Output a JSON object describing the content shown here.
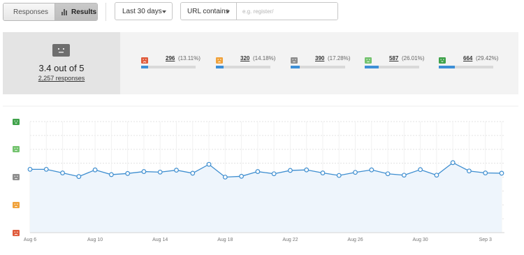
{
  "toolbar": {
    "tabs": [
      {
        "label": "Responses",
        "icon": "list-icon",
        "active": false
      },
      {
        "label": "Results",
        "icon": "bar-chart-icon",
        "active": true
      }
    ],
    "date_range": "Last 30 days",
    "url_filter": {
      "mode": "URL contains",
      "placeholder": "e.g. register/",
      "value": ""
    }
  },
  "summary": {
    "face_icon": "neutral-face-icon",
    "score": "3.4 out of 5",
    "responses": "2,257 responses",
    "ratings": [
      {
        "face": "very-unhappy-face-icon",
        "color": "#e05b3c",
        "count": "296",
        "percent": "(13.11%)",
        "fraction": 0.1311
      },
      {
        "face": "unhappy-face-icon",
        "color": "#f0a23b",
        "count": "320",
        "percent": "(14.18%)",
        "fraction": 0.1418
      },
      {
        "face": "neutral-face-icon",
        "color": "#8e8e8e",
        "count": "390",
        "percent": "(17.28%)",
        "fraction": 0.1728
      },
      {
        "face": "happy-face-icon",
        "color": "#74c36f",
        "count": "587",
        "percent": "(26.01%)",
        "fraction": 0.2601
      },
      {
        "face": "very-happy-face-icon",
        "color": "#3fa24a",
        "count": "664",
        "percent": "(29.42%)",
        "fraction": 0.2942
      }
    ]
  },
  "colors": {
    "line": "#3e8ed0",
    "area": "#eef5fc",
    "bar_fill": "#3d8fd6",
    "bar_track": "#d9d9d9"
  },
  "chart_data": {
    "type": "line",
    "title": "",
    "xlabel": "",
    "ylabel": "",
    "ylim": [
      1,
      5
    ],
    "grid": true,
    "y_axis_icons": [
      "very-happy-face-icon",
      "happy-face-icon",
      "neutral-face-icon",
      "unhappy-face-icon",
      "very-unhappy-face-icon"
    ],
    "x_tick_labels": [
      "Aug 6",
      "Aug 10",
      "Aug 14",
      "Aug 18",
      "Aug 22",
      "Aug 26",
      "Aug 30",
      "Sep 3"
    ],
    "x_tick_indices": [
      0,
      4,
      8,
      12,
      16,
      20,
      24,
      28
    ],
    "x": [
      "Aug 6",
      "Aug 7",
      "Aug 8",
      "Aug 9",
      "Aug 10",
      "Aug 11",
      "Aug 12",
      "Aug 13",
      "Aug 14",
      "Aug 15",
      "Aug 16",
      "Aug 17",
      "Aug 18",
      "Aug 19",
      "Aug 20",
      "Aug 21",
      "Aug 22",
      "Aug 23",
      "Aug 24",
      "Aug 25",
      "Aug 26",
      "Aug 27",
      "Aug 28",
      "Aug 29",
      "Aug 30",
      "Aug 31",
      "Sep 1",
      "Sep 2",
      "Sep 3",
      "Sep 4"
    ],
    "values": [
      3.28,
      3.28,
      3.15,
      3.02,
      3.26,
      3.09,
      3.13,
      3.2,
      3.18,
      3.25,
      3.14,
      3.46,
      3.0,
      3.03,
      3.2,
      3.12,
      3.24,
      3.26,
      3.15,
      3.06,
      3.17,
      3.26,
      3.12,
      3.07,
      3.27,
      3.07,
      3.52,
      3.22,
      3.15,
      3.14
    ]
  }
}
